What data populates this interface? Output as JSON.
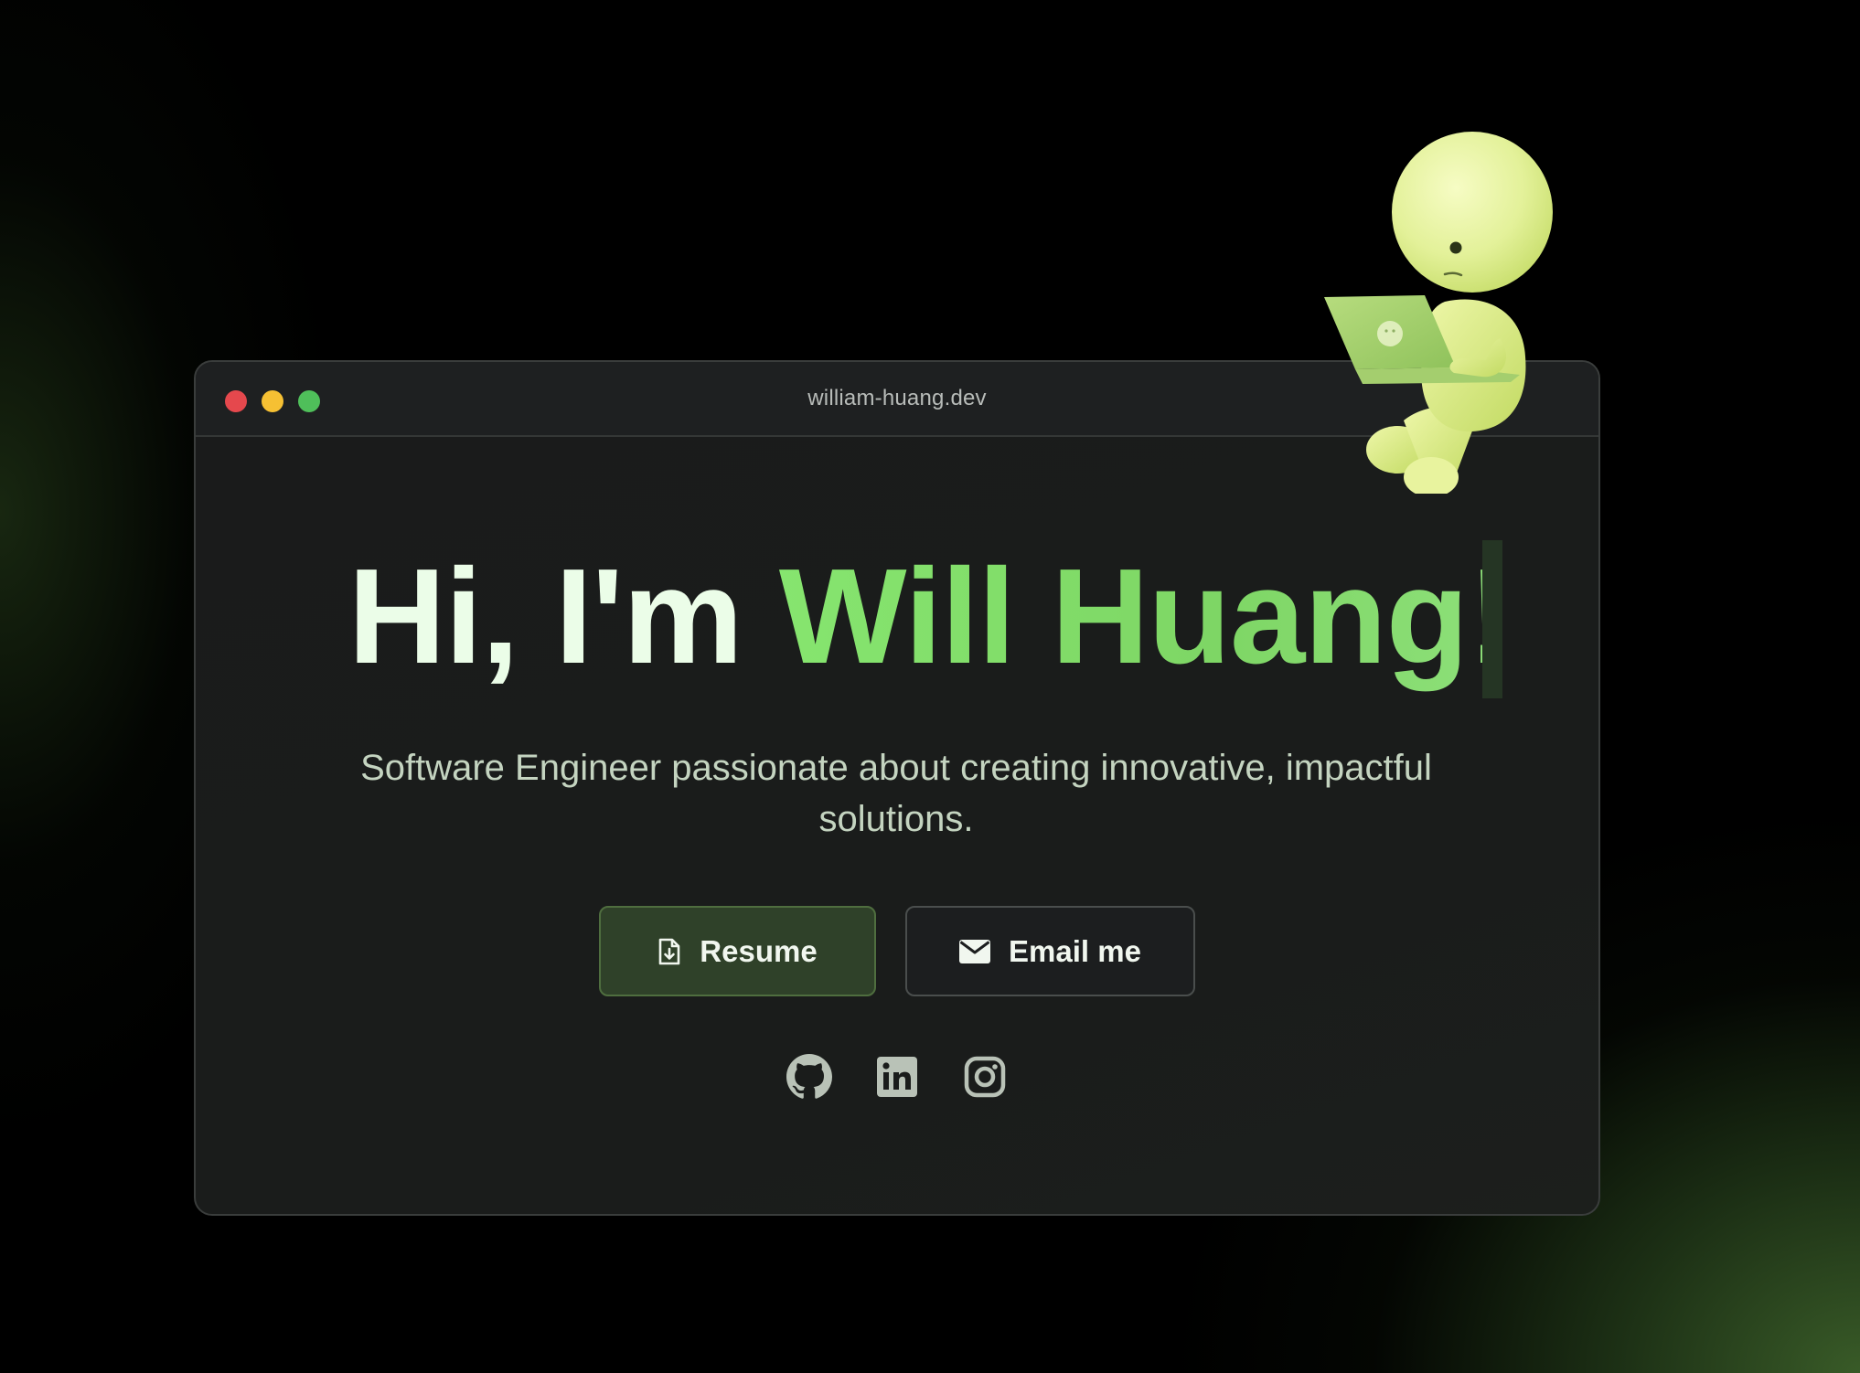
{
  "window": {
    "url": "william-huang.dev"
  },
  "hero": {
    "greeting": "Hi, I'm ",
    "name": "Will Huang!",
    "subtitle": "Software Engineer passionate about creating innovative, impactful solutions."
  },
  "buttons": {
    "resume": {
      "label": "Resume",
      "icon": "file-download-icon"
    },
    "email": {
      "label": "Email me",
      "icon": "envelope-icon"
    }
  },
  "social": [
    {
      "name": "GitHub",
      "icon": "github-icon"
    },
    {
      "name": "LinkedIn",
      "icon": "linkedin-icon"
    },
    {
      "name": "Instagram",
      "icon": "instagram-icon"
    }
  ],
  "colors": {
    "accent": "#86e56f",
    "resume_bg": "#2f4129",
    "window_bg": "#1a1b1b",
    "traffic_red": "#e5484d",
    "traffic_yellow": "#f6c033",
    "traffic_green": "#4fbf5a"
  }
}
